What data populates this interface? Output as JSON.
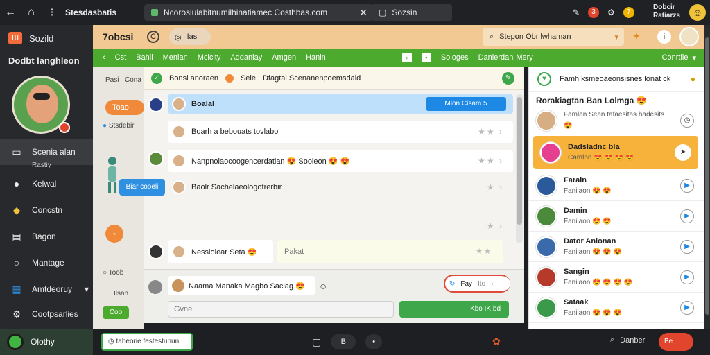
{
  "browser": {
    "title": "Stesdasbatis",
    "url": "Ncorosiulabitnumilhinatiamec Costhbas.com",
    "search_tab": "Sozsin",
    "notif_count1": "3",
    "notif_count2": "7",
    "user_line1": "Dobcir",
    "user_line2": "Ratiarzs",
    "accent": "#4caa2e"
  },
  "sidebar": {
    "app_name": "Sozild",
    "logo": "Ш",
    "user_name": "Dodbt langhleon",
    "items": [
      {
        "label": "Scenia alan",
        "icon": "monitor-icon"
      },
      {
        "label": "Kelwal",
        "icon": "person-icon"
      },
      {
        "label": "Concstn",
        "icon": "chat-icon"
      },
      {
        "label": "Bagon",
        "icon": "document-icon"
      },
      {
        "label": "Mantage",
        "icon": "search-icon"
      },
      {
        "label": "Amtdeoruy",
        "icon": "chart-icon"
      },
      {
        "label": "Cootpsarlies",
        "icon": "gear-icon"
      }
    ],
    "active_sub": "Rastiy",
    "bottom_label": "Olothy"
  },
  "app_header": {
    "title": "7obcsi",
    "c_label": "C",
    "pill_label": "Ias",
    "search_placeholder": "Stepon Obr lwhaman"
  },
  "toolbar": {
    "items": [
      "Cst",
      "Bahil",
      "Menlan",
      "Mclcity",
      "Addaniay",
      "Amgen",
      "Hanin"
    ],
    "right_items": [
      "Sologes",
      "Danlerdan",
      "Mery"
    ],
    "dropdown": "Conrtile"
  },
  "tool_column": {
    "label1": "Pasi",
    "label2": "Cona",
    "pill": "Toao",
    "sub": "Stsdebir",
    "callout": "Biar cooeli",
    "label3": "Toob",
    "label4": "Ilsan",
    "green_pill": "Coo"
  },
  "chat": {
    "header_left": "Bonsi anoraen",
    "header_mid": "Sele",
    "header_right": "Dfagtal Scenanenpoemsdald",
    "rows": [
      {
        "text": "Boalal",
        "button": "Mlon  Cisam 5"
      },
      {
        "text": "Boarh a bebouats tovlabo"
      },
      {
        "text": "Nanpnolaocoogencerdatian 😍 Sooleon 😍 😍"
      },
      {
        "text": "Baolr Sachelaeologotrerbir"
      },
      {
        "text": ""
      },
      {
        "text": "Nessiolear Seta 😍"
      }
    ],
    "side_row": "Pakat",
    "compose_msg": "Naama Manaka Magbo Saclag 😍",
    "reply": "Fay",
    "reply_sub": "Ito",
    "input_placeholder": "Gvne",
    "send": "Kbo  IK  bd"
  },
  "contacts": {
    "search": "Famh ksmeoaeonsisnes lonat ck",
    "title": "Rorakiagtan Ban Lolmga 😍",
    "items": [
      {
        "name": "Famlan Sean tafaesitas hadesits",
        "status": "😍"
      },
      {
        "name": "Dadsladnc bla",
        "status": "Camlon 😍 😍 😍 😍"
      },
      {
        "name": "Farain",
        "status": "Fanilaon 😍 😍"
      },
      {
        "name": "Damin",
        "status": "Fanilaon 😍 😍"
      },
      {
        "name": "Dator Anlonan",
        "status": "Fanilaon 😍 😍 😍"
      },
      {
        "name": "Sangin",
        "status": "Fanilaon 😍 😍 😍 😍"
      },
      {
        "name": "Sataak",
        "status": "Fanilaon 😍 😍 😍"
      }
    ]
  },
  "taskbar": {
    "timer": "taheorie festestunun",
    "btn1": "B",
    "btn2": "B",
    "btn3": "•",
    "right_label": "Danber",
    "pill": "Be"
  }
}
